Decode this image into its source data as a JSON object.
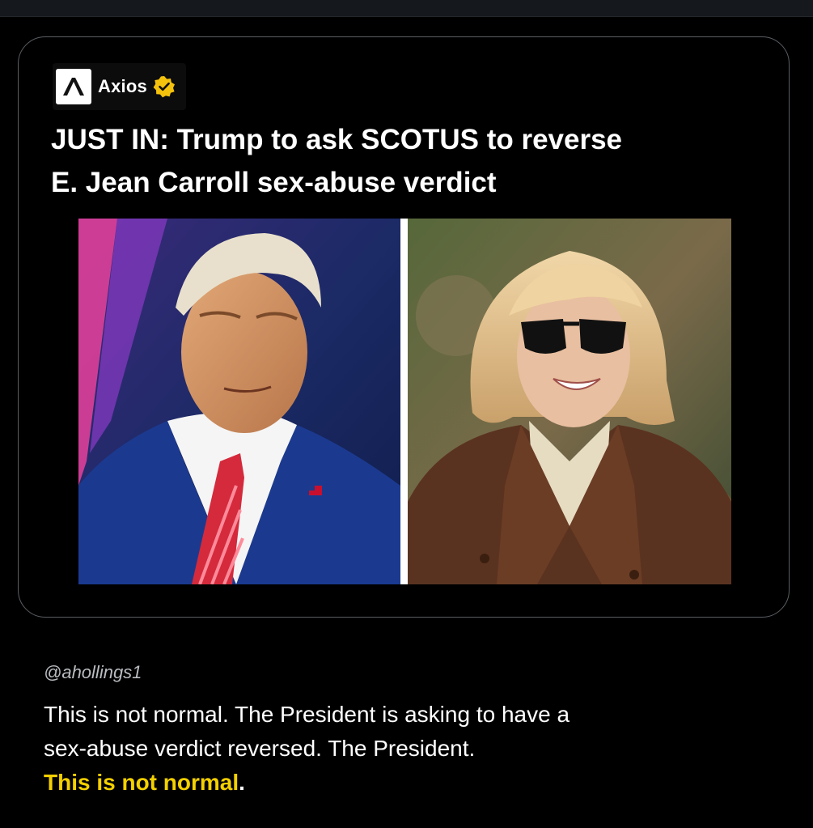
{
  "card": {
    "source_name": "Axios",
    "source_logo_icon": "axios-logo-icon",
    "verified_icon": "verified-badge-icon",
    "verified_color": "#f4c20d",
    "headline_line1": "JUST IN: Trump to ask SCOTUS to reverse",
    "headline_line2": "E. Jean Carroll sex-abuse verdict"
  },
  "images": {
    "left": "photo-man-red-tie",
    "right": "photo-woman-sunglasses"
  },
  "post": {
    "handle": "@ahollings1",
    "line1": "This is not normal. The President is asking to have a",
    "line2": "sex-abuse verdict reversed. The President.",
    "highlight": "This is not normal",
    "period": ".",
    "highlight_color": "#f4d000"
  }
}
